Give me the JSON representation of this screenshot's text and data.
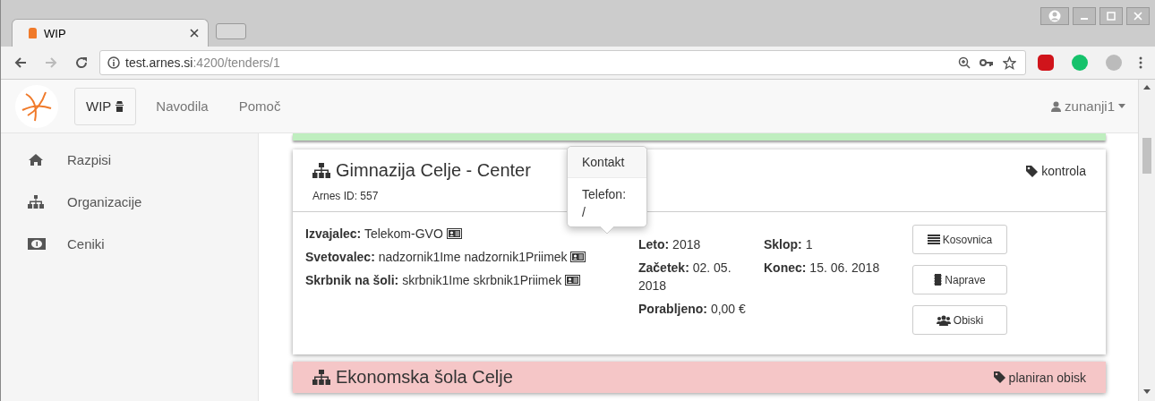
{
  "browser": {
    "tab_title": "WIP",
    "url_host": "test.arnes.si",
    "url_path": ":4200/tenders/1"
  },
  "navbar": {
    "brand": "WIP",
    "links": [
      "Navodila",
      "Pomoč"
    ],
    "user": "zunanji1"
  },
  "sidebar": {
    "items": [
      {
        "label": "Razpisi",
        "kind": "home"
      },
      {
        "label": "Organizacije",
        "kind": "org"
      },
      {
        "label": "Ceniki",
        "kind": "money"
      }
    ]
  },
  "cards": [
    {
      "title": "Gimnazija Celje - Center",
      "subtitle": "Arnes ID: 557",
      "tag": "kontrola",
      "people": [
        {
          "label": "Izvajalec:",
          "value": "Telekom-GVO"
        },
        {
          "label": "Svetovalec:",
          "value": "nadzornik1Ime nadzornik1Priimek"
        },
        {
          "label": "Skrbnik na šoli:",
          "value": "skrbnik1Ime skrbnik1Priimek"
        }
      ],
      "col2": [
        {
          "label": "Leto:",
          "value": "2018"
        },
        {
          "label": "Začetek:",
          "value": "02. 05. 2018"
        },
        {
          "label": "Porabljeno:",
          "value": "0,00 €"
        }
      ],
      "col3": [
        {
          "label": "Sklop:",
          "value": "1"
        },
        {
          "label": "Konec:",
          "value": "15. 06. 2018"
        }
      ],
      "buttons": [
        {
          "label": "Kosovnica",
          "kind": "list"
        },
        {
          "label": "Naprave",
          "kind": "chip"
        },
        {
          "label": "Obiski",
          "kind": "users"
        }
      ],
      "popover": {
        "title": "Kontakt",
        "body": "Telefon: /"
      }
    },
    {
      "title": "Ekonomska šola Celje",
      "tag": "planiran obisk"
    }
  ]
}
